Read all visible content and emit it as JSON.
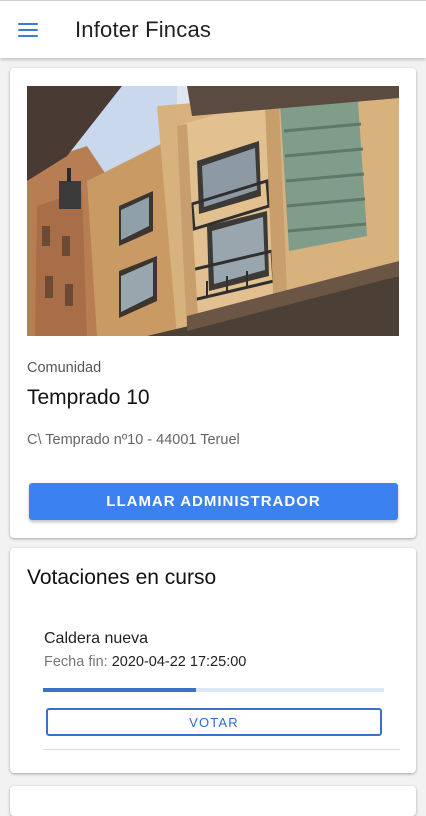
{
  "app_bar": {
    "title": "Infoter Fincas",
    "menu_icon": "hamburger-menu-icon"
  },
  "community": {
    "label": "Comunidad",
    "name": "Temprado 10",
    "address": "C\\ Temprado nº10 - 44001 Teruel",
    "call_button": "LLAMAR ADMINISTRADOR"
  },
  "votes": {
    "title": "Votaciones en curso",
    "items": [
      {
        "name": "Caldera nueva",
        "end_label": "Fecha fin:",
        "end_value": "2020-04-22 17:25:00",
        "progress_fraction": 0.45,
        "vote_button": "VOTAR"
      }
    ]
  },
  "colors": {
    "accent": "#3b82f0",
    "progress": "#3a72c8"
  }
}
